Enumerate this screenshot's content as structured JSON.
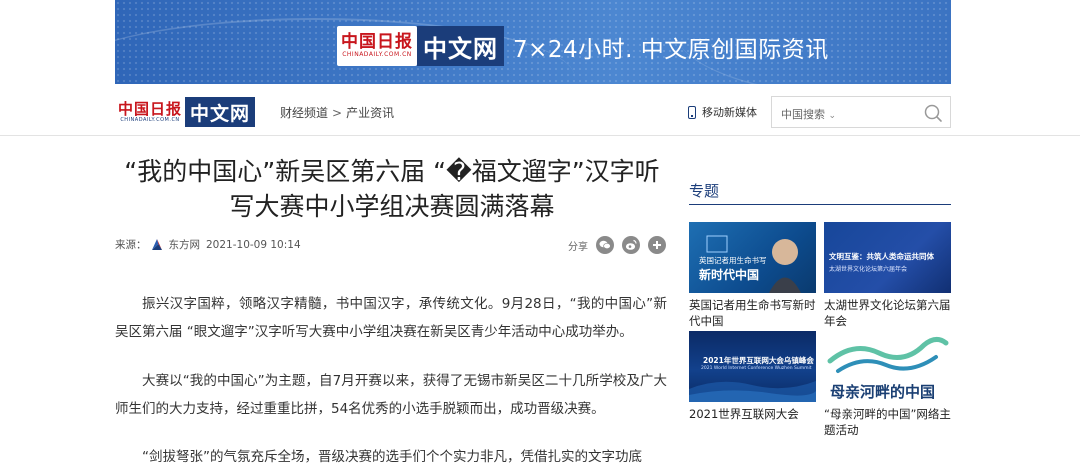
{
  "banner": {
    "logo_cn": "中国日报",
    "logo_en": "CHINADAILY.COM.CN",
    "logo_zw": "中文网",
    "slogan": "7×24小时. 中文原创国际资讯"
  },
  "header": {
    "logo_cn": "中国日报",
    "logo_en": "CHINADAILY.COM.CN",
    "logo_zw": "中文网",
    "breadcrumb": [
      "财经频道",
      "产业资讯"
    ],
    "breadcrumb_sep": ">",
    "mobile_label": "移动新媒体",
    "search_select": "中国搜索",
    "search_value": ""
  },
  "article": {
    "title": "“我的中国心”新吴区第六届 “�福文遛字”汉字听写大赛中小学组决赛圆满落幕",
    "source_label": "来源：",
    "source": "东方网",
    "datetime": "2021-10-09 10:14",
    "share_label": "分享",
    "paragraphs": [
      "振兴汉字国粹，领略汉字精髓，书中国汉字，承传统文化。9月28日，“我的中国心”新吴区第六届 “眼文遛字”汉字听写大赛中小学组决赛在新吴区青少年活动中心成功举办。",
      "大赛以“我的中国心”为主题，自7月开赛以来，获得了无锡市新吴区二十几所学校及广大师生们的大力支持，经过重重比拼，54名优秀的小选手脱颖而出，成功晋级决赛。",
      "“剑拔弩张”的气氛充斥全场，晋级决赛的选手们个个实力非凡，凭借扎实的文字功底"
    ]
  },
  "sidebar": {
    "title": "专题",
    "cards": [
      {
        "caption": "英国记者用生命书写新时代中国",
        "thumb_line1": "英国记者用生命书写",
        "thumb_line2": "新时代中国"
      },
      {
        "caption": "太湖世界文化论坛第六届年会",
        "thumb_line1": "文明互鉴：共筑人类命运共同体",
        "thumb_line2": "太湖世界文化论坛第六届年会"
      },
      {
        "caption": "2021世界互联网大会",
        "thumb_line1": "2021年世界互联网大会乌镇峰会",
        "thumb_line2": "2021 World Internet Conference Wuzhen Summit"
      },
      {
        "caption": "“母亲河畔的中国”网络主题活动",
        "thumb_line1": "母亲河畔的中国"
      }
    ]
  },
  "colors": {
    "brand_blue": "#1b3d7a",
    "brand_red": "#c8161d",
    "banner_blue": "#3f78c6"
  }
}
